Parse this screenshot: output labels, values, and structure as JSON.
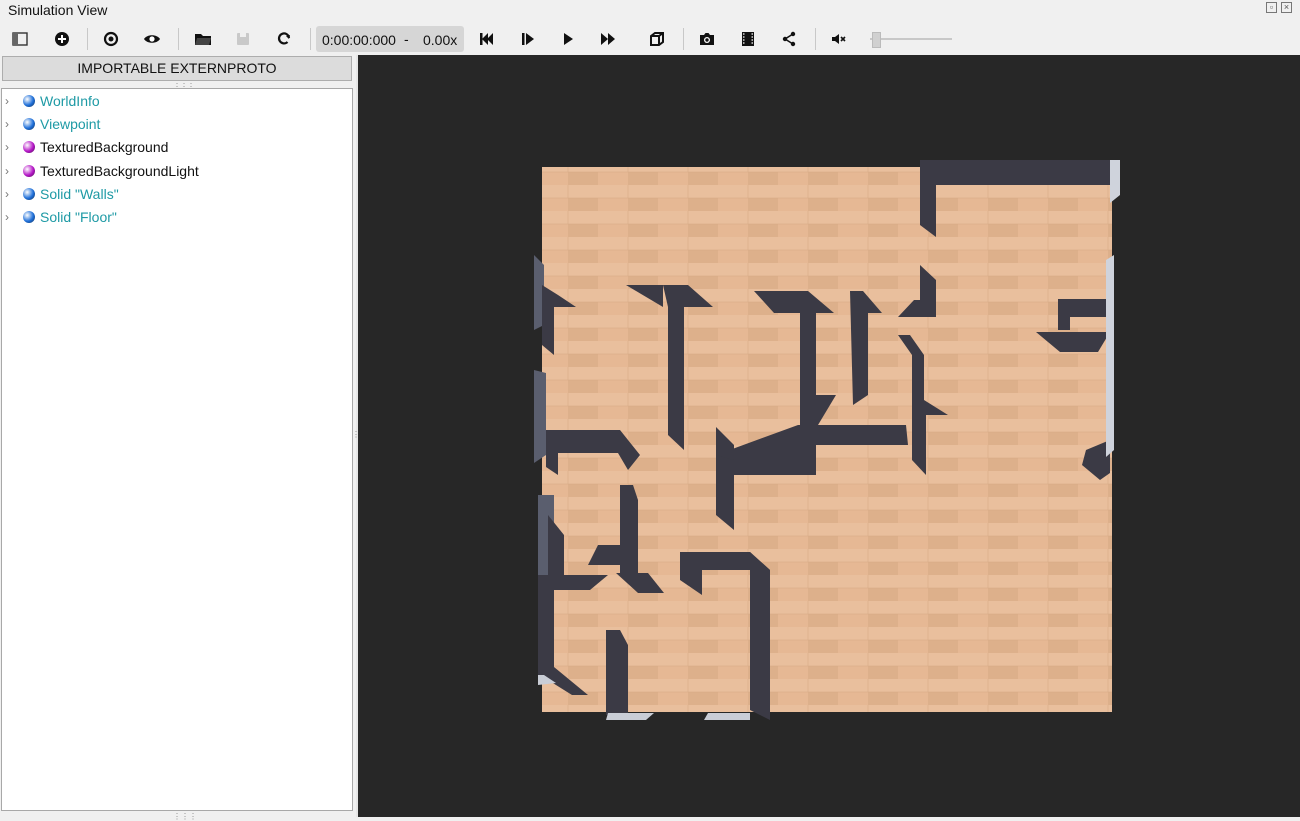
{
  "window": {
    "title": "Simulation View"
  },
  "toolbar": {
    "time": "0:00:00:000",
    "time_separator": "-",
    "speed": "0.00x",
    "volume_level": 0.0
  },
  "scene_tree": {
    "header_button": "IMPORTABLE EXTERNPROTO",
    "nodes": [
      {
        "label": "WorldInfo",
        "color": "#1e9aa5",
        "ball": "#1e6fd9"
      },
      {
        "label": "Viewpoint",
        "color": "#1e9aa5",
        "ball": "#1e6fd9"
      },
      {
        "label": "TexturedBackground",
        "color": "#111111",
        "ball": "#b516c7"
      },
      {
        "label": "TexturedBackgroundLight",
        "color": "#111111",
        "ball": "#b516c7"
      },
      {
        "label": "Solid \"Walls\"",
        "color": "#1e9aa5",
        "ball": "#1e6fd9"
      },
      {
        "label": "Solid \"Floor\"",
        "color": "#1e9aa5",
        "ball": "#1e6fd9"
      }
    ]
  },
  "viewport": {
    "background": "#272727",
    "floor_color": "#e6b894",
    "wall_color": "#3b3a45"
  }
}
